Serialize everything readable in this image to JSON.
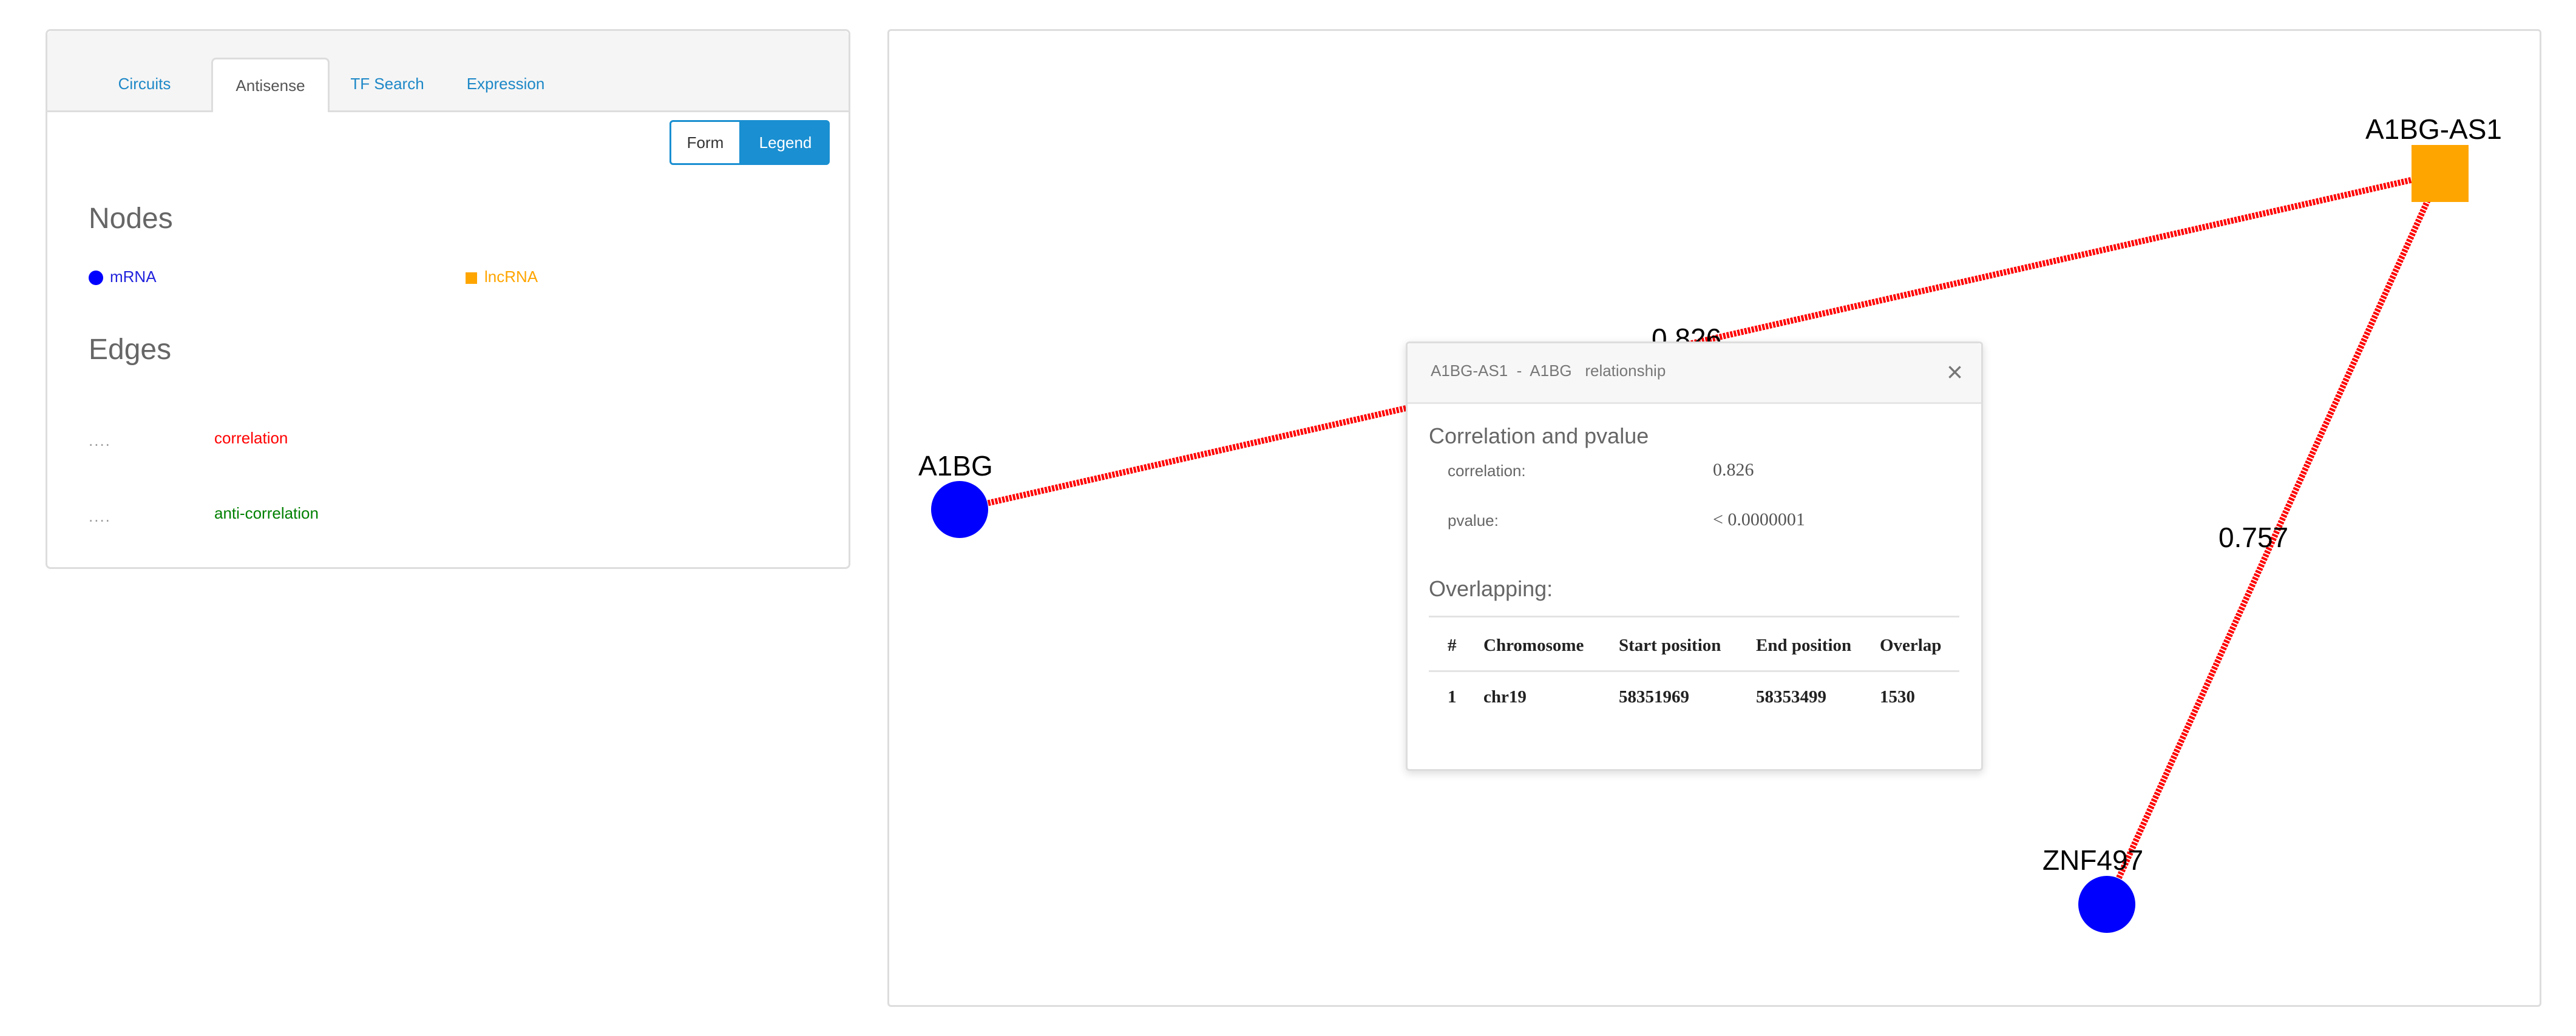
{
  "tabs": [
    {
      "label": "Circuits"
    },
    {
      "label": "Antisense"
    },
    {
      "label": "TF Search"
    },
    {
      "label": "Expression"
    }
  ],
  "buttons": {
    "form": "Form",
    "legend": "Legend"
  },
  "legend": {
    "nodes_title": "Nodes",
    "mrna_label": "mRNA",
    "lncrna_label": "lncRNA",
    "edges_title": "Edges",
    "correlation_dots": "....",
    "correlation_label": "correlation",
    "anticorrelation_dots": "....",
    "anticorrelation_label": "anti-correlation",
    "colors": {
      "mrna": "#0000ff",
      "lncrna": "#ffa500",
      "correlation": "#ff0000",
      "anticorrelation": "#008000"
    }
  },
  "graph": {
    "nodes": [
      {
        "id": "A1BG",
        "label": "A1BG",
        "type": "mRNA"
      },
      {
        "id": "A1BG-AS1",
        "label": "A1BG-AS1",
        "type": "lncRNA"
      },
      {
        "id": "ZNF497",
        "label": "ZNF497",
        "type": "mRNA"
      }
    ],
    "edges": [
      {
        "source": "A1BG",
        "target": "A1BG-AS1",
        "weight": "0.826",
        "type": "correlation"
      },
      {
        "source": "A1BG-AS1",
        "target": "ZNF497",
        "weight": "0.757",
        "type": "correlation"
      }
    ]
  },
  "popup": {
    "title": "A1BG-AS1  -  A1BG   relationship",
    "close_icon": "×",
    "section1_title": "Correlation and pvalue",
    "correlation_label": "correlation:",
    "correlation_value": "0.826",
    "pvalue_label": "pvalue:",
    "pvalue_value": "< 0.0000001",
    "section2_title": "Overlapping:",
    "table": {
      "headers": [
        "#",
        "Chromosome",
        "Start position",
        "End position",
        "Overlap"
      ],
      "rows": [
        [
          "1",
          "chr19",
          "58351969",
          "58353499",
          "1530"
        ]
      ]
    }
  }
}
